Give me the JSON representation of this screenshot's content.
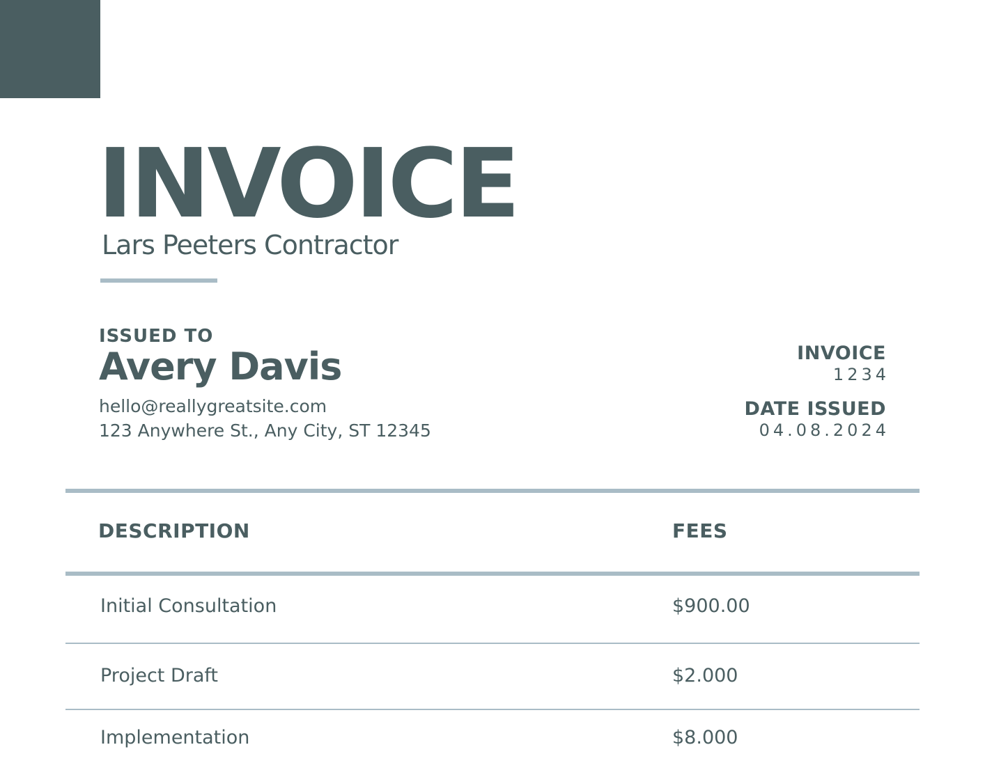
{
  "document": {
    "title": "INVOICE",
    "subtitle": "Lars Peeters Contractor"
  },
  "issued_to": {
    "label": "ISSUED TO",
    "name": "Avery Davis",
    "email": "hello@reallygreatsite.com",
    "address": "123 Anywhere St., Any City, ST 12345"
  },
  "meta": {
    "invoice_label": "INVOICE",
    "invoice_number": "1234",
    "date_label": "DATE ISSUED",
    "date_value": "04.08.2024"
  },
  "table": {
    "headers": {
      "description": "DESCRIPTION",
      "fees": "FEES"
    },
    "rows": [
      {
        "description": "Initial Consultation",
        "fee": "$900.00"
      },
      {
        "description": "Project Draft",
        "fee": "$2.000"
      },
      {
        "description": "Implementation",
        "fee": "$8.000"
      }
    ]
  },
  "colors": {
    "primary": "#4a5e61",
    "accent_rule": "#a9bcc6",
    "background": "#ffffff"
  }
}
